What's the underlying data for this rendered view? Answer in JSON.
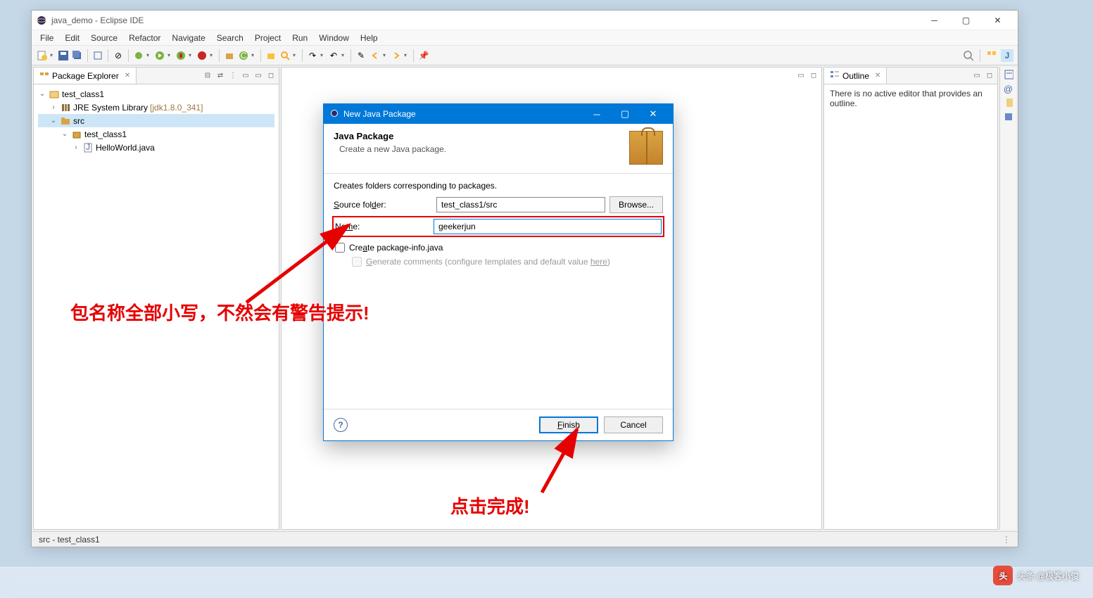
{
  "window": {
    "title": "java_demo - Eclipse IDE"
  },
  "menu": [
    "File",
    "Edit",
    "Source",
    "Refactor",
    "Navigate",
    "Search",
    "Project",
    "Run",
    "Window",
    "Help"
  ],
  "explorer": {
    "title": "Package Explorer",
    "project": "test_class1",
    "jre": "JRE System Library",
    "jre_ver": "[jdk1.8.0_341]",
    "src": "src",
    "pkg": "test_class1",
    "file": "HelloWorld.java"
  },
  "outline": {
    "title": "Outline",
    "msg": "There is no active editor that provides an outline."
  },
  "dialog": {
    "title": "New Java Package",
    "header": "Java Package",
    "desc": "Create a new Java package.",
    "info": "Creates folders corresponding to packages.",
    "source_label": "Source folder:",
    "source_value": "test_class1/src",
    "browse": "Browse...",
    "name_label": "Name:",
    "name_value": "geekerjun",
    "chk1": "Create package-info.java",
    "chk2_prefix": "Generate comments (configure templates and default value ",
    "chk2_link": "here",
    "chk2_suffix": ")",
    "finish": "Finish",
    "cancel": "Cancel"
  },
  "status": "src - test_class1",
  "annotations": {
    "a1": "包名称全部小写，不然会有警告提示!",
    "a2": "点击完成!"
  },
  "watermark": "头条 @极客小俊"
}
